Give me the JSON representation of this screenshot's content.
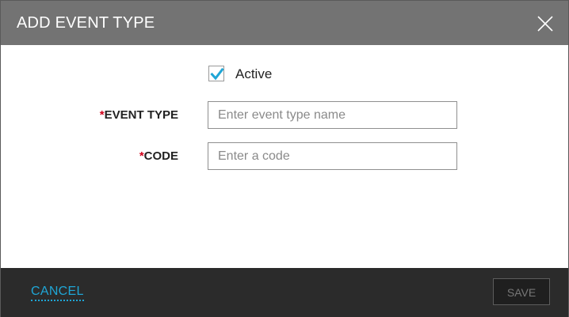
{
  "dialog": {
    "title": "ADD EVENT TYPE",
    "close_icon": "close-icon"
  },
  "form": {
    "active": {
      "label": "Active",
      "checked": true,
      "check_color": "#1fa6d6"
    },
    "event_type": {
      "required_mark": "*",
      "label": "EVENT TYPE",
      "placeholder": "Enter event type name",
      "value": ""
    },
    "code": {
      "required_mark": "*",
      "label": "CODE",
      "placeholder": "Enter a code",
      "value": ""
    }
  },
  "footer": {
    "cancel_label": "CANCEL",
    "save_label": "SAVE"
  },
  "colors": {
    "header_bg": "#737373",
    "footer_bg": "#2b2b2b",
    "accent": "#1fa6d6",
    "required": "#d0021b"
  }
}
